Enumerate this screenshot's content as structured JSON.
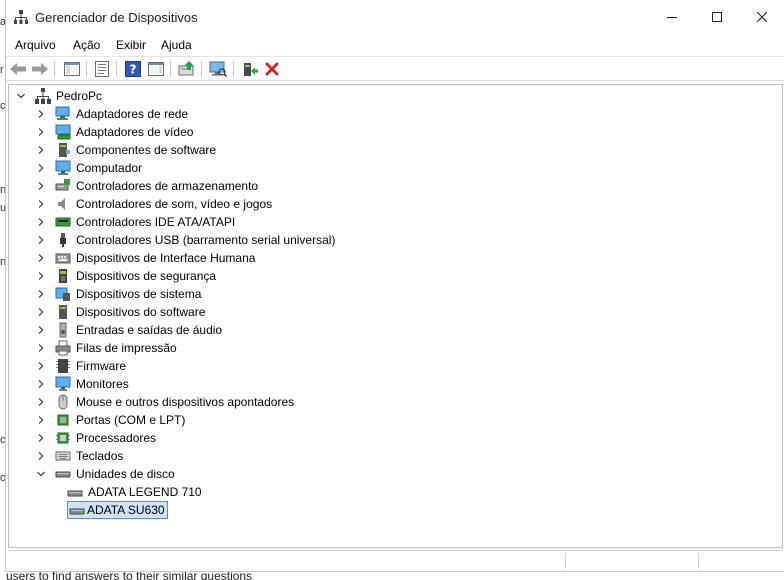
{
  "window": {
    "title": "Gerenciador de Dispositivos"
  },
  "menubar": {
    "items": [
      "Arquivo",
      "Ação",
      "Exibir",
      "Ajuda"
    ]
  },
  "toolbar": {
    "buttons": [
      "back-arrow-icon",
      "forward-arrow-icon",
      "show-hide-console-tree-icon",
      "properties-icon",
      "help-icon",
      "action-pane-icon",
      "update-driver-icon",
      "scan-hardware-icon",
      "enable-device-icon",
      "uninstall-device-icon"
    ]
  },
  "tree": {
    "root": "PedroPc",
    "categories": [
      {
        "label": "Adaptadores de rede",
        "icon": "network-adapter-icon"
      },
      {
        "label": "Adaptadores de vídeo",
        "icon": "display-adapter-icon"
      },
      {
        "label": "Componentes de software",
        "icon": "software-component-icon"
      },
      {
        "label": "Computador",
        "icon": "computer-icon"
      },
      {
        "label": "Controladores de armazenamento",
        "icon": "storage-controller-icon"
      },
      {
        "label": "Controladores de som, vídeo e jogos",
        "icon": "sound-icon"
      },
      {
        "label": "Controladores IDE ATA/ATAPI",
        "icon": "ide-controller-icon"
      },
      {
        "label": "Controladores USB (barramento serial universal)",
        "icon": "usb-icon"
      },
      {
        "label": "Dispositivos de Interface Humana",
        "icon": "hid-icon"
      },
      {
        "label": "Dispositivos de segurança",
        "icon": "security-device-icon"
      },
      {
        "label": "Dispositivos de sistema",
        "icon": "system-device-icon"
      },
      {
        "label": "Dispositivos do software",
        "icon": "software-device-icon"
      },
      {
        "label": "Entradas e saídas de áudio",
        "icon": "audio-io-icon"
      },
      {
        "label": "Filas de impressão",
        "icon": "printer-icon"
      },
      {
        "label": "Firmware",
        "icon": "firmware-icon"
      },
      {
        "label": "Monitores",
        "icon": "monitor-icon"
      },
      {
        "label": "Mouse e outros dispositivos apontadores",
        "icon": "mouse-icon"
      },
      {
        "label": "Portas (COM e LPT)",
        "icon": "port-icon"
      },
      {
        "label": "Processadores",
        "icon": "processor-icon"
      },
      {
        "label": "Teclados",
        "icon": "keyboard-icon"
      },
      {
        "label": "Unidades de disco",
        "icon": "disk-drive-icon"
      }
    ],
    "disk_children": [
      {
        "label": "ADATA LEGEND 710",
        "selected": false
      },
      {
        "label": "ADATA SU630",
        "selected": true
      }
    ]
  },
  "background": {
    "left_chars": [
      "a",
      "r",
      "c",
      "n",
      "u",
      "n",
      "c",
      "o"
    ],
    "bottom_text": "users to find answers to their similar questions"
  },
  "colors": {
    "selection_fill": "#cfe2f6",
    "selection_border": "#5a8fc7",
    "delete_red": "#d42020"
  }
}
